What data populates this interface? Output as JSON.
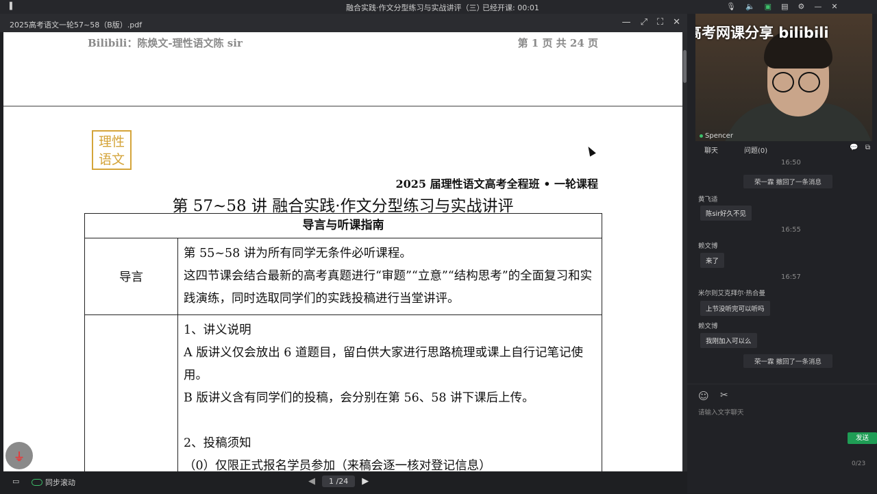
{
  "topbar": {
    "signal": "▐",
    "title": "融合实践·作文分型练习与实战讲评（三）",
    "timer": "已经开课: 00:01"
  },
  "viewer": {
    "filename": "2025高考语文一轮57~58（B版）.pdf",
    "header_left": "Bilibili：陈焕文-理性语文陈 sir",
    "header_right": "第 1 页 共 24 页",
    "logo_line1": "理性",
    "logo_line2": "语文",
    "course": "2025 届理性语文高考全程班 • 一轮课程",
    "lecture": "第 57~58 讲 融合实践·作文分型练习与实战讲评",
    "table_title": "导言与听课指南",
    "row1_label": "导言",
    "row1_lines": [
      "第 55~58 讲为所有同学无条件必听课程。",
      "这四节课会结合最新的高考真题进行“审题”“立意”“结构思考”的全面复习和实践演练，同时选取同学们的实践投稿进行当堂讲评。"
    ],
    "row2_lines": [
      "1、讲义说明",
      "A 版讲义仅会放出 6 道题目，留白供大家进行思路梳理或课上自行记笔记使用。",
      "B 版讲义含有同学们的投稿，会分别在第 56、58 讲下课后上传。",
      "",
      "2、投稿须知",
      "（0）仅限正式报名学员参加（来稿会逐一核对登记信息）"
    ]
  },
  "bottombar": {
    "sync_label": "同步滚动",
    "page_indicator": "1 /24"
  },
  "camera": {
    "watermark": "高考网课分享 bilibili",
    "speaker_name": "Spencer"
  },
  "chat": {
    "tab_chat": "聊天",
    "tab_questions": "问题(0)",
    "messages": [
      {
        "type": "time",
        "text": "16:50"
      },
      {
        "type": "system",
        "text": "荣一霖 撤回了一条消息"
      },
      {
        "type": "msg",
        "sender": "黄飞适",
        "text": "陈sir好久不见"
      },
      {
        "type": "time",
        "text": "16:55"
      },
      {
        "type": "msg",
        "sender": "赖文博",
        "text": "来了"
      },
      {
        "type": "time",
        "text": "16:57"
      },
      {
        "type": "msg",
        "sender": "米尔则艾克拜尔·热合曼",
        "text": "上节没听完可以听吗"
      },
      {
        "type": "msg",
        "sender": "赖文博",
        "text": "我刚加入可以么"
      },
      {
        "type": "system",
        "text": "荣一霖 撤回了一条消息"
      }
    ],
    "input_placeholder": "请输入文字聊天",
    "send_label": "发送",
    "char_count": "0/23"
  }
}
